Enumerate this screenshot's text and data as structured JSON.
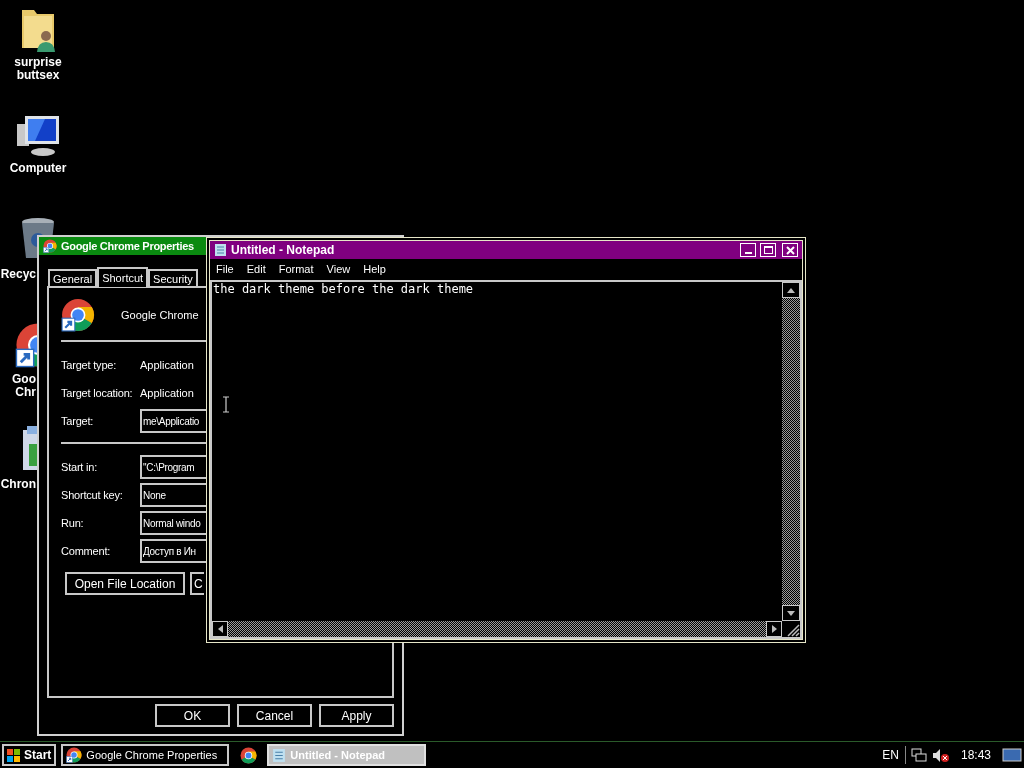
{
  "desktop_icons": [
    {
      "kind": "folder-person",
      "lines": [
        "surprise",
        "buttsex"
      ]
    },
    {
      "kind": "computer",
      "lines": [
        "Computer"
      ]
    },
    {
      "kind": "recycle-bin",
      "lines": [
        "Recyc"
      ]
    },
    {
      "kind": "chrome-shortcut",
      "lines": [
        "Goo",
        "Chr"
      ]
    },
    {
      "kind": "installer",
      "lines": [
        "Chron"
      ]
    }
  ],
  "properties_window": {
    "title": "Google Chrome Properties",
    "tabs": [
      {
        "label": "General",
        "selected": false
      },
      {
        "label": "Shortcut",
        "selected": true
      },
      {
        "label": "Security",
        "selected": false
      }
    ],
    "app_name": "Google Chrome",
    "sections": [
      [
        {
          "kind": "text",
          "label": "Target type:",
          "value": "Application"
        },
        {
          "kind": "text",
          "label": "Target location:",
          "value": "Application"
        },
        {
          "kind": "field",
          "label": "Target:",
          "value": "me\\Applicatio"
        }
      ],
      [
        {
          "kind": "field",
          "label": "Start in:",
          "value": "\"C:\\Program"
        },
        {
          "kind": "field",
          "label": "Shortcut key:",
          "value": "None"
        },
        {
          "kind": "field",
          "label": "Run:",
          "value": "Normal windo"
        },
        {
          "kind": "field",
          "label": "Comment:",
          "value": "Доступ в Ин"
        }
      ]
    ],
    "action_buttons": [
      "Open File Location",
      "C"
    ],
    "footer_buttons": [
      "OK",
      "Cancel",
      "Apply"
    ]
  },
  "notepad": {
    "title": "Untitled - Notepad",
    "menu": [
      "File",
      "Edit",
      "Format",
      "View",
      "Help"
    ],
    "text": "the dark theme before the dark theme"
  },
  "taskbar": {
    "start": "Start",
    "tasks": [
      {
        "kind": "properties",
        "label": "Google Chrome Properties",
        "selected": false
      },
      {
        "kind": "chrome",
        "selected": false
      },
      {
        "kind": "notepad",
        "label": "Untitled - Notepad",
        "selected": true
      }
    ],
    "language": "EN",
    "clock": "18:43"
  }
}
